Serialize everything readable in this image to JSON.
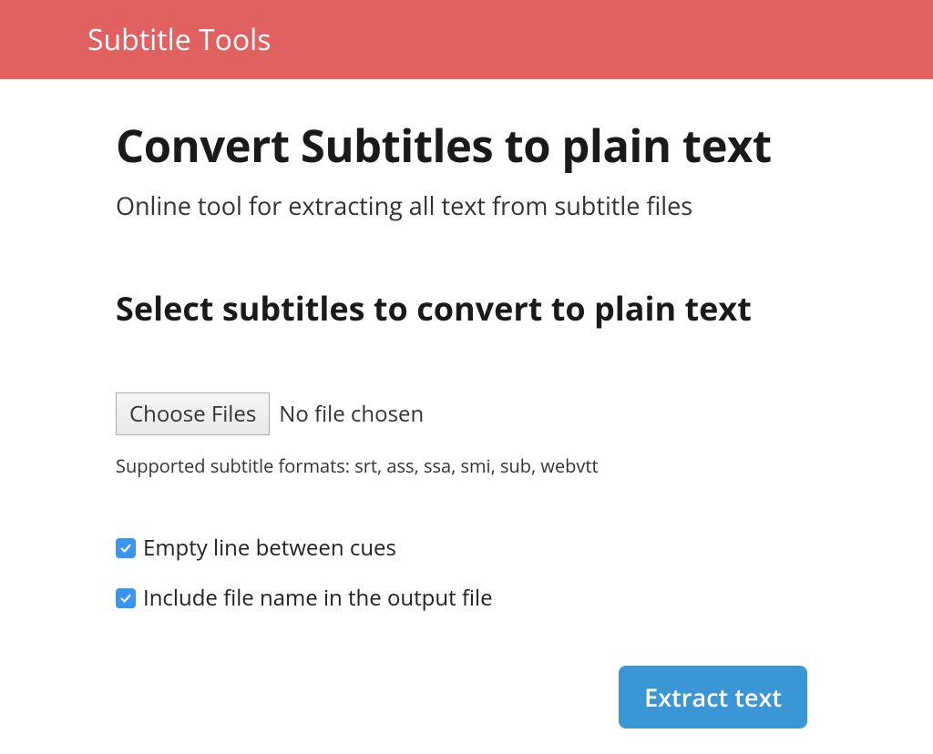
{
  "header": {
    "title": "Subtitle Tools"
  },
  "main": {
    "title": "Convert Subtitles to plain text",
    "subtitle": "Online tool for extracting all text from subtitle files",
    "section_title": "Select subtitles to convert to plain text",
    "choose_files_label": "Choose Files",
    "file_status": "No file chosen",
    "supported_formats": "Supported subtitle formats: srt, ass, ssa, smi, sub, webvtt",
    "checkbox_empty_line": "Empty line between cues",
    "checkbox_include_filename": "Include file name in the output file",
    "submit_label": "Extract text"
  }
}
